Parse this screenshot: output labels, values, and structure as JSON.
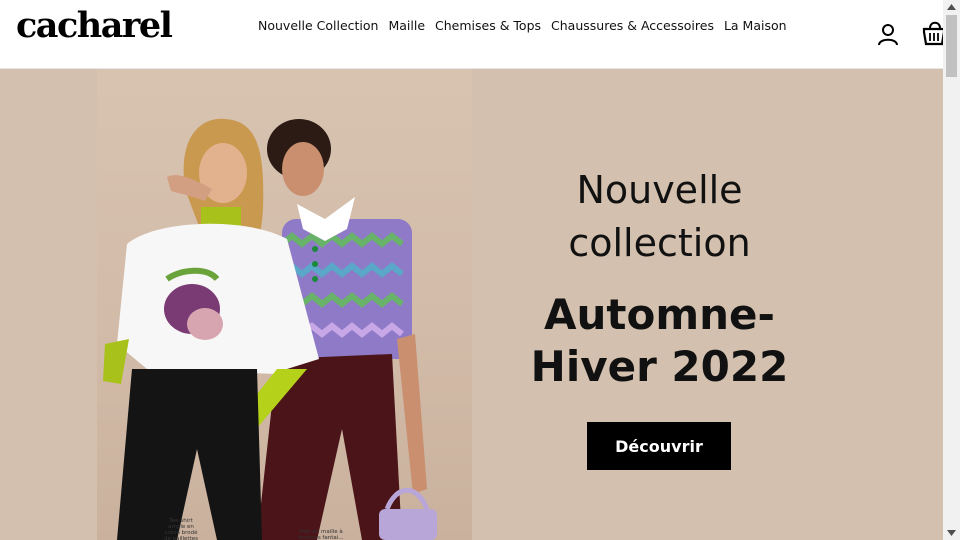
{
  "brand": {
    "logo_text": "cacharel"
  },
  "nav": {
    "items": [
      {
        "label": "Nouvelle Collection"
      },
      {
        "label": "Maille"
      },
      {
        "label": "Chemises & Tops"
      },
      {
        "label": "Chaussures & Accessoires"
      },
      {
        "label": "La Maison"
      }
    ]
  },
  "header_icons": [
    "user-icon",
    "basket-icon"
  ],
  "hero": {
    "subtitle_line1": "Nouvelle",
    "subtitle_line2": "collection",
    "title_line1": "Automne-",
    "title_line2": "Hiver 2022",
    "cta_label": "Découvrir",
    "caption_left": "Tee-shirt ample en coton brodé de paillettes",
    "caption_right": "Polo en maille à boutons fantai..."
  },
  "colors": {
    "hero_background": "#d3c0ae",
    "button_background": "#000000",
    "button_text": "#ffffff"
  }
}
